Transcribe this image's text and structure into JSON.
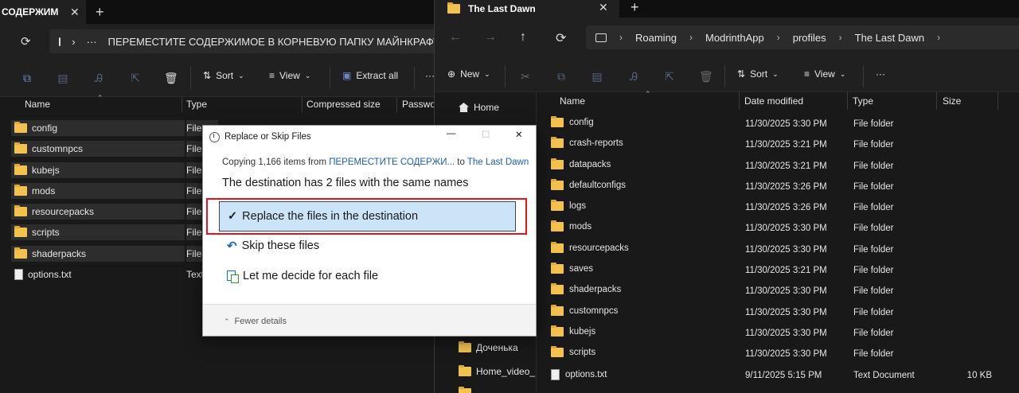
{
  "left_window": {
    "tab_title": "СОДЕРЖИМОЕ",
    "address_path": "ПЕРЕМЕСТИТЕ СОДЕРЖИМОЕ В КОРНЕВУЮ ПАПКУ МАЙНКРАФТ",
    "toolbar": {
      "sort_label": "Sort",
      "view_label": "View",
      "extract_label": "Extract all",
      "more_label": "···"
    },
    "columns": [
      "Name",
      "Type",
      "Compressed size",
      "Password"
    ],
    "files": [
      {
        "name": "config",
        "type": "File",
        "icon": "folder"
      },
      {
        "name": "customnpcs",
        "type": "File",
        "icon": "folder"
      },
      {
        "name": "kubejs",
        "type": "File",
        "icon": "folder"
      },
      {
        "name": "mods",
        "type": "File",
        "icon": "folder"
      },
      {
        "name": "resourcepacks",
        "type": "File",
        "icon": "folder"
      },
      {
        "name": "scripts",
        "type": "File",
        "icon": "folder"
      },
      {
        "name": "shaderpacks",
        "type": "File",
        "icon": "folder"
      },
      {
        "name": "options.txt",
        "type": "Text",
        "icon": "text-file"
      }
    ]
  },
  "right_window": {
    "tab_title": "The Last Dawn",
    "breadcrumb": [
      "Roaming",
      "ModrinthApp",
      "profiles",
      "The Last Dawn"
    ],
    "toolbar": {
      "new_label": "New",
      "sort_label": "Sort",
      "view_label": "View",
      "more_label": "···"
    },
    "nav_items": [
      "Home",
      "Доченька",
      "Home_video_"
    ],
    "columns": [
      "Name",
      "Date modified",
      "Type",
      "Size"
    ],
    "files": [
      {
        "name": "config",
        "date": "11/30/2025 3:30 PM",
        "type": "File folder",
        "size": ""
      },
      {
        "name": "crash-reports",
        "date": "11/30/2025 3:21 PM",
        "type": "File folder",
        "size": ""
      },
      {
        "name": "datapacks",
        "date": "11/30/2025 3:21 PM",
        "type": "File folder",
        "size": ""
      },
      {
        "name": "defaultconfigs",
        "date": "11/30/2025 3:26 PM",
        "type": "File folder",
        "size": ""
      },
      {
        "name": "logs",
        "date": "11/30/2025 3:26 PM",
        "type": "File folder",
        "size": ""
      },
      {
        "name": "mods",
        "date": "11/30/2025 3:30 PM",
        "type": "File folder",
        "size": ""
      },
      {
        "name": "resourcepacks",
        "date": "11/30/2025 3:30 PM",
        "type": "File folder",
        "size": ""
      },
      {
        "name": "saves",
        "date": "11/30/2025 3:21 PM",
        "type": "File folder",
        "size": ""
      },
      {
        "name": "shaderpacks",
        "date": "11/30/2025 3:30 PM",
        "type": "File folder",
        "size": ""
      },
      {
        "name": "customnpcs",
        "date": "11/30/2025 3:30 PM",
        "type": "File folder",
        "size": ""
      },
      {
        "name": "kubejs",
        "date": "11/30/2025 3:30 PM",
        "type": "File folder",
        "size": ""
      },
      {
        "name": "scripts",
        "date": "11/30/2025 3:30 PM",
        "type": "File folder",
        "size": ""
      },
      {
        "name": "options.txt",
        "date": "9/11/2025 5:15 PM",
        "type": "Text Document",
        "size": "10 KB"
      }
    ]
  },
  "dialog": {
    "title": "Replace or Skip Files",
    "copy_prefix": "Copying 1,166 items from ",
    "copy_source": "ПЕРЕМЕСТИТЕ СОДЕРЖИ...",
    "copy_to": " to ",
    "copy_dest": "The Last Dawn",
    "destination_message": "The destination has 2 files with the same names",
    "options": {
      "replace": "Replace the files in the destination",
      "skip": "Skip these files",
      "decide": "Let me decide for each file"
    },
    "fewer_details": "Fewer details",
    "highlight_color": "#e5141b"
  }
}
